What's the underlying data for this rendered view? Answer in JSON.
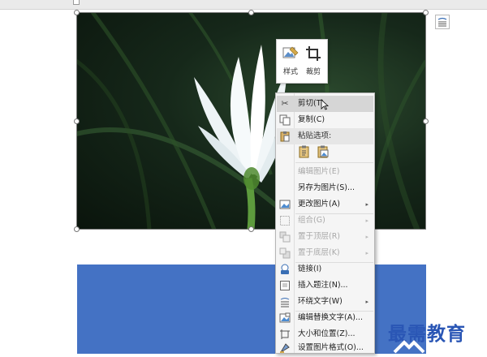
{
  "mini_toolbar": {
    "style_label": "样式",
    "crop_label": "裁剪"
  },
  "context_menu": {
    "items": [
      {
        "label": "剪切(T)",
        "icon": "scissors-icon",
        "state": "highlighted"
      },
      {
        "label": "复制(C)",
        "icon": "copy-icon",
        "state": "normal"
      },
      {
        "label": "粘贴选项:",
        "icon": "paste-icon",
        "state": "header"
      },
      {
        "label": "编辑图片(E)",
        "icon": "",
        "state": "disabled"
      },
      {
        "label": "另存为图片(S)...",
        "icon": "",
        "state": "normal"
      },
      {
        "label": "更改图片(A)",
        "icon": "change-picture-icon",
        "state": "normal",
        "submenu": true
      },
      {
        "label": "组合(G)",
        "icon": "group-icon",
        "state": "disabled",
        "submenu": true
      },
      {
        "label": "置于顶层(R)",
        "icon": "bring-front-icon",
        "state": "disabled",
        "submenu": true
      },
      {
        "label": "置于底层(K)",
        "icon": "send-back-icon",
        "state": "disabled",
        "submenu": true
      },
      {
        "label": "链接(I)",
        "icon": "link-icon",
        "state": "normal"
      },
      {
        "label": "插入题注(N)...",
        "icon": "caption-icon",
        "state": "normal"
      },
      {
        "label": "环绕文字(W)",
        "icon": "wrap-text-icon",
        "state": "normal",
        "submenu": true
      },
      {
        "label": "编辑替换文字(A)...",
        "icon": "alt-text-icon",
        "state": "normal"
      },
      {
        "label": "大小和位置(Z)...",
        "icon": "size-position-icon",
        "state": "normal"
      },
      {
        "label": "设置图片格式(O)...",
        "icon": "format-picture-icon",
        "state": "normal"
      }
    ],
    "paste_options": [
      "paste-keep-format-icon",
      "paste-picture-icon"
    ],
    "submenu_arrow": "▸"
  },
  "watermark": {
    "text": "最需教育"
  },
  "colors": {
    "accent_blue": "#4472c4",
    "menu_bg": "#f5f5f5",
    "menu_highlight": "#d6d6d6",
    "watermark": "#2a56b5"
  }
}
